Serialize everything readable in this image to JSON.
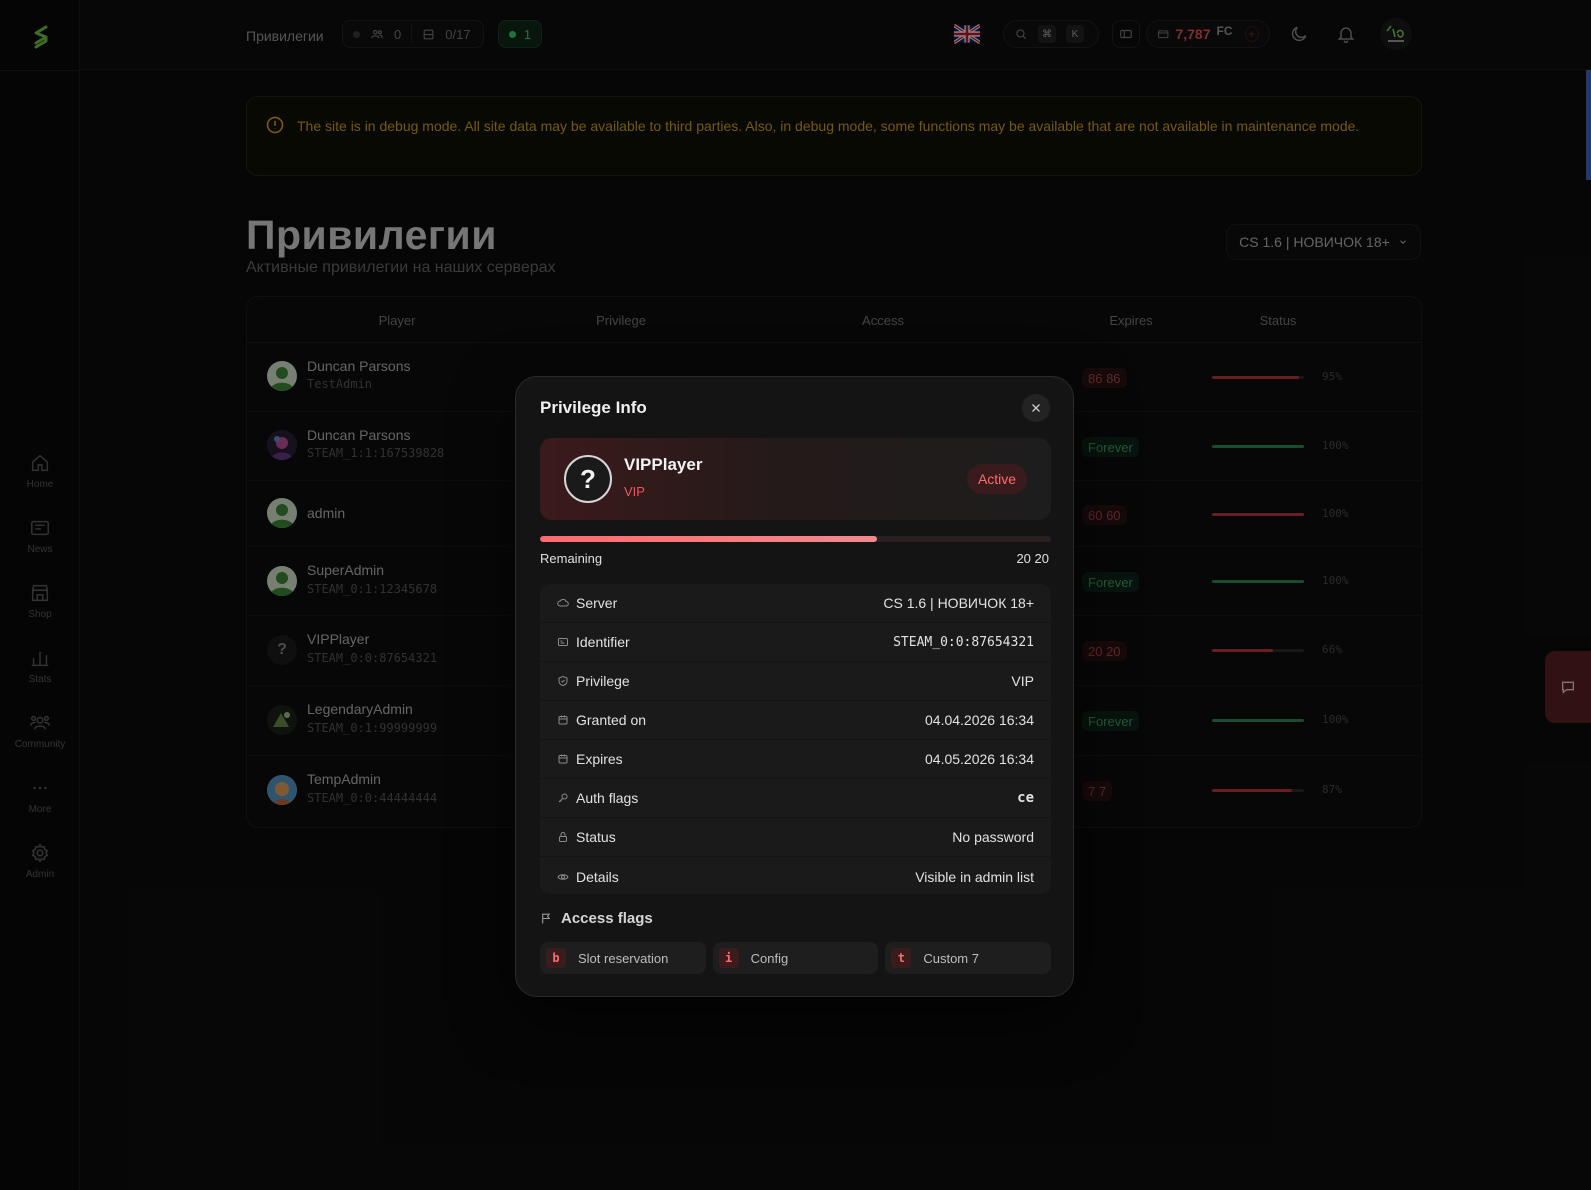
{
  "topbar": {
    "title": "Привилегии",
    "players_count": "0",
    "servers_count": "0/17",
    "online_count": "1",
    "kbd1": "⌘",
    "kbd2": "K",
    "balance": "7,787",
    "currency": "FC"
  },
  "sidebar": {
    "items": [
      {
        "label": "Home",
        "icon": "home-icon"
      },
      {
        "label": "News",
        "icon": "news-icon"
      },
      {
        "label": "Shop",
        "icon": "shop-icon"
      },
      {
        "label": "Stats",
        "icon": "stats-icon"
      },
      {
        "label": "Community",
        "icon": "community-icon"
      },
      {
        "label": "More",
        "icon": "more-icon"
      },
      {
        "label": "Admin",
        "icon": "gear-icon"
      }
    ]
  },
  "banner": {
    "text": "The site is in debug mode. All site data may be available to third parties. Also, in debug mode, some functions may be available that are not available in maintenance mode."
  },
  "page": {
    "title": "Привилегии",
    "subtitle": "Активные привилегии на наших серверах",
    "server_select": "CS 1.6 | НОВИЧОК 18+"
  },
  "table": {
    "headers": [
      "Player",
      "Privilege",
      "Access",
      "Expires",
      "Status"
    ],
    "rows": [
      {
        "name": "Duncan Parsons",
        "id": "TestAdmin",
        "expires": "86 86",
        "expires_type": "red",
        "status_pct": 95,
        "status_label": "95%"
      },
      {
        "name": "Duncan Parsons",
        "id": "STEAM_1:1:167539828",
        "expires": "Forever",
        "expires_type": "green",
        "status_pct": 100,
        "status_label": "100%"
      },
      {
        "name": "admin",
        "id": "",
        "expires": "60 60",
        "expires_type": "red",
        "status_pct": 100,
        "status_label": "100%"
      },
      {
        "name": "SuperAdmin",
        "id": "STEAM_0:1:12345678",
        "expires": "Forever",
        "expires_type": "green",
        "status_pct": 100,
        "status_label": "100%"
      },
      {
        "name": "VIPPlayer",
        "id": "STEAM_0:0:87654321",
        "expires": "20 20",
        "expires_type": "red",
        "status_pct": 66,
        "status_label": "66%"
      },
      {
        "name": "LegendaryAdmin",
        "id": "STEAM_0:1:99999999",
        "expires": "Forever",
        "expires_type": "green",
        "status_pct": 100,
        "status_label": "100%"
      },
      {
        "name": "TempAdmin",
        "id": "STEAM_0:0:44444444",
        "expires": "7 7",
        "expires_type": "red",
        "status_pct": 87,
        "status_label": "87%"
      }
    ]
  },
  "modal": {
    "title": "Privilege Info",
    "player_name": "VIPPlayer",
    "group": "VIP",
    "active_badge": "Active",
    "avatar_glyph": "?",
    "progress_pct": 66,
    "remaining_label": "Remaining",
    "remaining_value": "20 20",
    "info": [
      {
        "key": "Server",
        "value": "CS 1.6 | НОВИЧОК 18+",
        "icon": "server-icon"
      },
      {
        "key": "Identifier",
        "value": "STEAM_0:0:87654321",
        "icon": "id-card-icon",
        "mono": true
      },
      {
        "key": "Privilege",
        "value": "VIP",
        "icon": "shield-icon"
      },
      {
        "key": "Granted on",
        "value": "04.04.2026 16:34",
        "icon": "calendar-icon"
      },
      {
        "key": "Expires",
        "value": "04.05.2026 16:34",
        "icon": "calendar-icon"
      },
      {
        "key": "Auth flags",
        "value": "ce",
        "icon": "key-icon",
        "mono": true
      },
      {
        "key": "Status",
        "value": "No password",
        "icon": "lock-icon"
      },
      {
        "key": "Details",
        "value": "Visible in admin list",
        "icon": "eye-icon"
      }
    ],
    "flags_title": "Access flags",
    "flags": [
      {
        "letter": "b",
        "label": "Slot reservation"
      },
      {
        "letter": "i",
        "label": "Config"
      },
      {
        "letter": "t",
        "label": "Custom 7"
      }
    ]
  },
  "colors": {
    "accent_red": "#ff6a6e",
    "accent_green": "#39d27a",
    "warning": "#d4a017"
  }
}
